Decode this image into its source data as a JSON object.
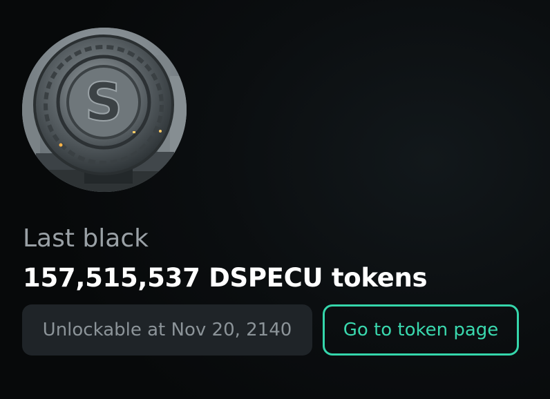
{
  "token_image": {
    "alt_icon": "stone-coin-s-logo-icon",
    "logo_letter": "S"
  },
  "lock": {
    "label": "Last black",
    "amount": "157,515,537 DSPECU tokens",
    "unlock_text": "Unlockable at Nov 20, 2140"
  },
  "actions": {
    "token_page_label": "Go to token page"
  },
  "colors": {
    "accent": "#35d6ab",
    "background": "#0b0e10",
    "unlock_box": "#1f2428"
  }
}
